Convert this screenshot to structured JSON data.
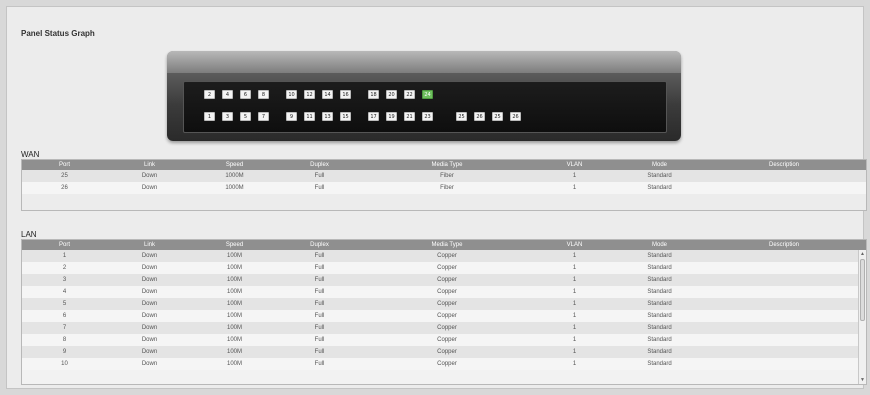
{
  "panel": {
    "title": "Panel Status Graph"
  },
  "ports_top": [
    "2",
    "4",
    "6",
    "8",
    "10",
    "12",
    "14",
    "16",
    "18",
    "20",
    "22",
    "24"
  ],
  "ports_bottom": [
    "1",
    "3",
    "5",
    "7",
    "9",
    "11",
    "13",
    "15",
    "17",
    "19",
    "21",
    "23"
  ],
  "ports_extra": [
    "25",
    "26",
    "25",
    "26"
  ],
  "active_port": "24",
  "wan": {
    "label": "WAN",
    "columns": [
      "Port",
      "Link",
      "Speed",
      "Duplex",
      "Media Type",
      "VLAN",
      "Mode",
      "Description"
    ],
    "rows": [
      [
        "25",
        "Down",
        "1000M",
        "Full",
        "Fiber",
        "1",
        "Standard",
        ""
      ],
      [
        "26",
        "Down",
        "1000M",
        "Full",
        "Fiber",
        "1",
        "Standard",
        ""
      ]
    ]
  },
  "lan": {
    "label": "LAN",
    "columns": [
      "Port",
      "Link",
      "Speed",
      "Duplex",
      "Media Type",
      "VLAN",
      "Mode",
      "Description"
    ],
    "rows": [
      [
        "1",
        "Down",
        "100M",
        "Full",
        "Copper",
        "1",
        "Standard",
        ""
      ],
      [
        "2",
        "Down",
        "100M",
        "Full",
        "Copper",
        "1",
        "Standard",
        ""
      ],
      [
        "3",
        "Down",
        "100M",
        "Full",
        "Copper",
        "1",
        "Standard",
        ""
      ],
      [
        "4",
        "Down",
        "100M",
        "Full",
        "Copper",
        "1",
        "Standard",
        ""
      ],
      [
        "5",
        "Down",
        "100M",
        "Full",
        "Copper",
        "1",
        "Standard",
        ""
      ],
      [
        "6",
        "Down",
        "100M",
        "Full",
        "Copper",
        "1",
        "Standard",
        ""
      ],
      [
        "7",
        "Down",
        "100M",
        "Full",
        "Copper",
        "1",
        "Standard",
        ""
      ],
      [
        "8",
        "Down",
        "100M",
        "Full",
        "Copper",
        "1",
        "Standard",
        ""
      ],
      [
        "9",
        "Down",
        "100M",
        "Full",
        "Copper",
        "1",
        "Standard",
        ""
      ],
      [
        "10",
        "Down",
        "100M",
        "Full",
        "Copper",
        "1",
        "Standard",
        ""
      ]
    ]
  },
  "colors": {
    "header": "#8f8f8f",
    "active_port": "#6fbf5f"
  }
}
